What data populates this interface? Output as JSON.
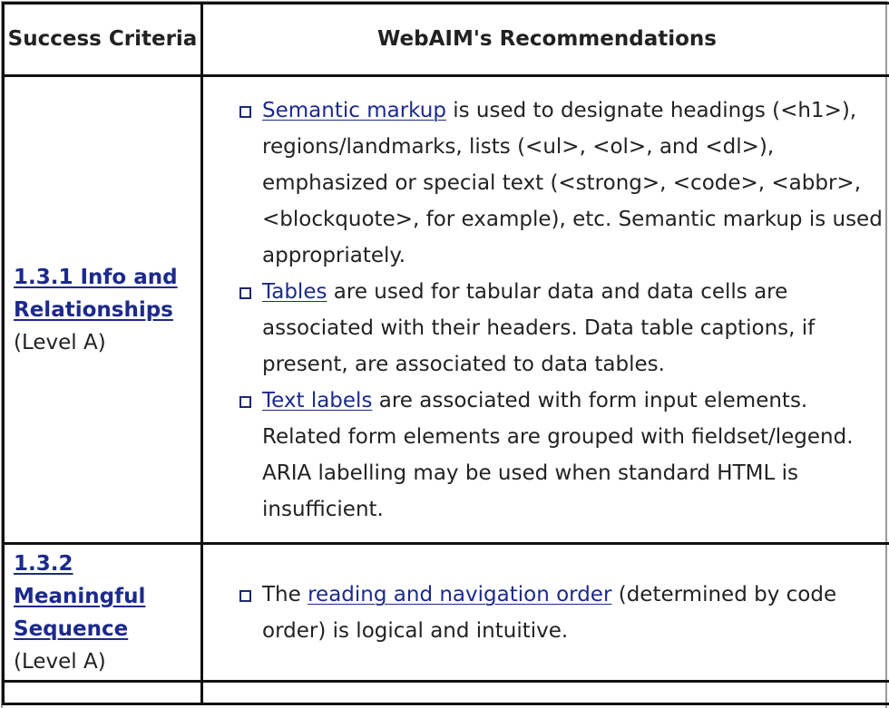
{
  "table": {
    "headers": {
      "col1": "Success Criteria",
      "col2": "WebAIM's Recommendations"
    },
    "rows": [
      {
        "criterion": {
          "link": "1.3.1 Info and Relationships",
          "level": "(Level A)"
        },
        "recommendations": [
          {
            "link": "Semantic markup",
            "text": " is used to designate headings (<h1>), regions/landmarks, lists (<ul>, <ol>, and <dl>), emphasized or special text (<strong>, <code>, <abbr>, <blockquote>, for example), etc. Semantic markup is used appropriately."
          },
          {
            "link": "Tables",
            "text": " are used for tabular data and data cells are associated with their headers. Data table captions, if present, are associated to data tables."
          },
          {
            "link": "Text labels",
            "text": " are associated with form input elements. Related form elements are grouped with fieldset/legend. ARIA labelling may be used when standard HTML is insufficient."
          }
        ]
      },
      {
        "criterion": {
          "link": "1.3.2 Meaningful Sequence",
          "level": "(Level A)"
        },
        "recommendations": [
          {
            "prefix": "The ",
            "link": "reading and navigation order",
            "text": " (determined by code order) is logical and intuitive."
          }
        ]
      }
    ]
  },
  "colors": {
    "link": "#1c2a8c",
    "text": "#222222",
    "border": "#111111"
  }
}
